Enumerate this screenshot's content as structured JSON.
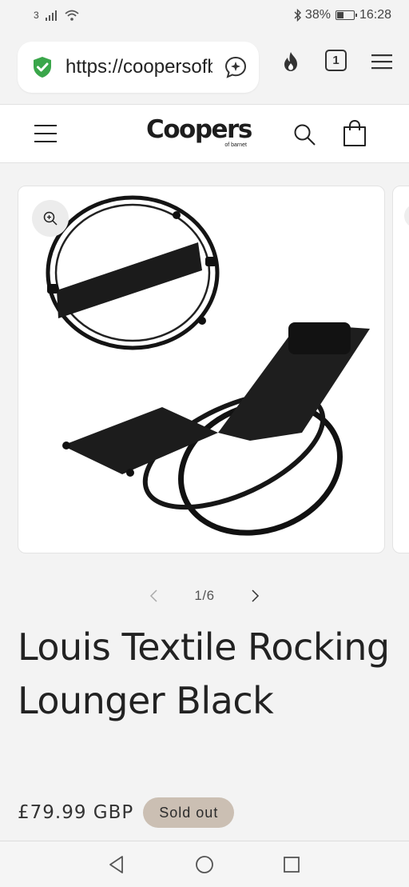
{
  "status_bar": {
    "sim": "3",
    "battery": "38%",
    "battery_level": 0.38,
    "time": "16:28"
  },
  "browser": {
    "url": "https://coopersofbarnet.co.uk",
    "tab_count": "1",
    "icons": [
      "shield-check-icon",
      "ai-assistant-icon",
      "flame-icon",
      "tab-switcher-icon",
      "menu-icon"
    ]
  },
  "site": {
    "logo_main": "Coopers",
    "logo_sub": "of barnet",
    "icons": [
      "hamburger-menu-icon",
      "search-icon",
      "cart-icon"
    ]
  },
  "gallery": {
    "current": 1,
    "total": 6,
    "counter": "1/6"
  },
  "product": {
    "title": "Louis Textile Rocking Lounger Black",
    "price": "£79.99 GBP",
    "badge": "Sold out"
  },
  "colors": {
    "badge_bg": "#cbbfb3",
    "shield_green": "#3aa64a",
    "text": "#222222"
  }
}
